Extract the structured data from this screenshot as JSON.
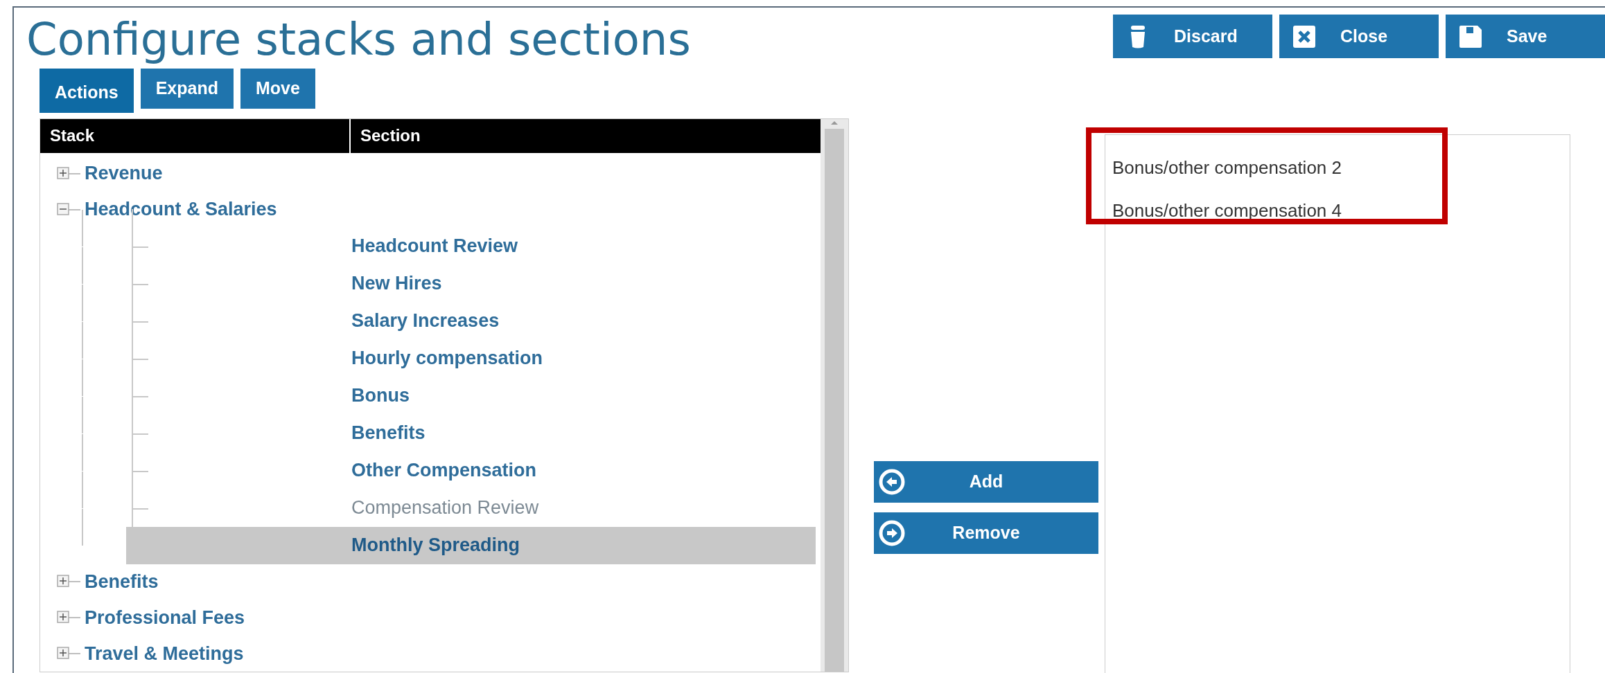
{
  "title": "Configure stacks and sections",
  "toolbar_buttons": [
    {
      "label": "Discard",
      "kind": "discard"
    },
    {
      "label": "Close",
      "kind": "close"
    },
    {
      "label": "Save",
      "kind": "save"
    }
  ],
  "tabs": [
    {
      "label": "Actions",
      "selected": true
    },
    {
      "label": "Expand",
      "selected": false
    },
    {
      "label": "Move",
      "selected": false
    }
  ],
  "tree": {
    "columns": [
      "Stack",
      "Section"
    ],
    "rows": [
      {
        "label": "Revenue",
        "expanded": false
      },
      {
        "label": "Headcount & Salaries",
        "expanded": true,
        "children": [
          {
            "label": "Headcount Review",
            "disabled": false,
            "selected": false
          },
          {
            "label": "New Hires",
            "disabled": false,
            "selected": false
          },
          {
            "label": "Salary Increases",
            "disabled": false,
            "selected": false
          },
          {
            "label": "Hourly compensation",
            "disabled": false,
            "selected": false
          },
          {
            "label": "Bonus",
            "disabled": false,
            "selected": false
          },
          {
            "label": "Benefits",
            "disabled": false,
            "selected": false
          },
          {
            "label": "Other Compensation",
            "disabled": false,
            "selected": false
          },
          {
            "label": "Compensation Review",
            "disabled": true,
            "selected": false
          },
          {
            "label": "Monthly Spreading",
            "disabled": false,
            "selected": true
          }
        ]
      },
      {
        "label": "Benefits",
        "expanded": false
      },
      {
        "label": "Professional Fees",
        "expanded": false
      },
      {
        "label": "Travel & Meetings",
        "expanded": false
      }
    ]
  },
  "transfer_buttons": [
    {
      "label": "Add",
      "kind": "add"
    },
    {
      "label": "Remove",
      "kind": "remove"
    }
  ],
  "selected_list": {
    "highlighted": true,
    "items": [
      {
        "label": "Bonus/other compensation 2"
      },
      {
        "label": "Bonus/other compensation 4"
      }
    ]
  }
}
